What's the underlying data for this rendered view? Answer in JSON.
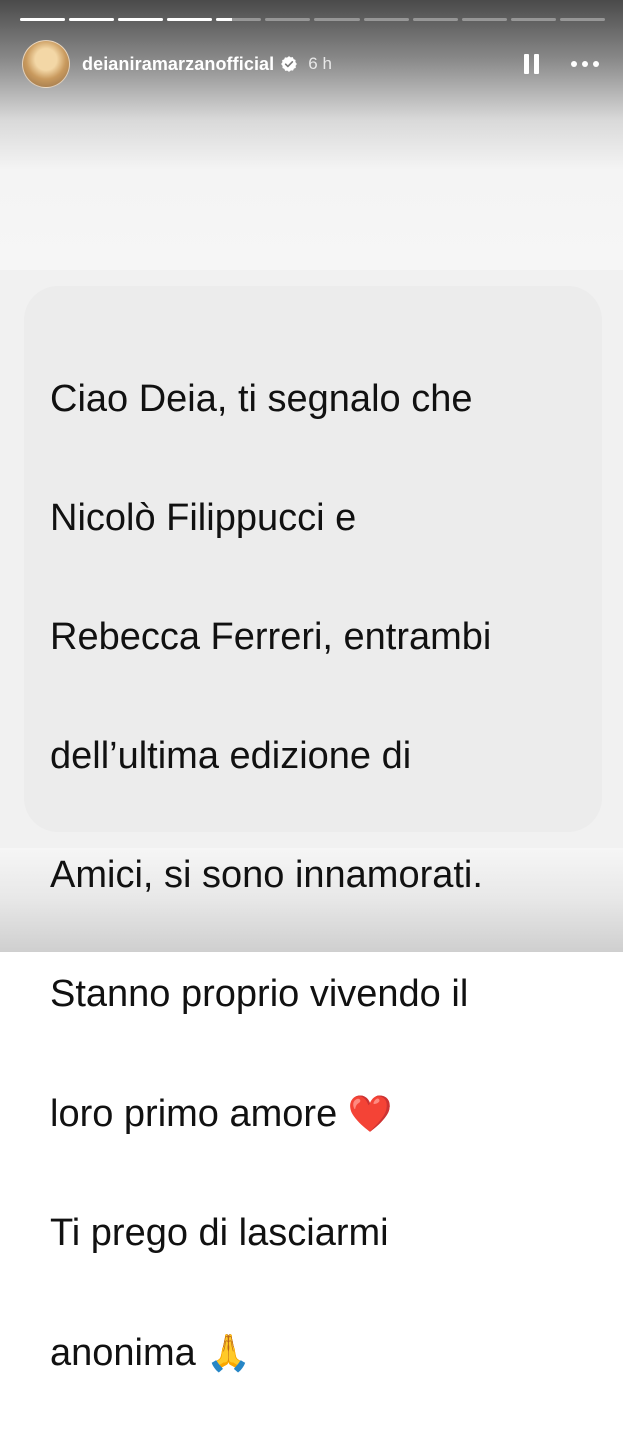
{
  "story": {
    "progress_segments": 12,
    "progress_completed": 4,
    "progress_current_fraction": 0.35,
    "username": "deianiramarzanofficial",
    "time_ago": "6 h",
    "verified": true,
    "icons": [
      "pause-icon",
      "more-icon",
      "verified-icon"
    ]
  },
  "message": {
    "lines": [
      "Ciao Deia, ti segnalo che",
      "Nicolò Filippucci e",
      "Rebecca Ferreri, entrambi",
      "dell’ultima edizione di",
      "Amici, si sono innamorati.",
      "Stanno proprio vivendo il",
      "loro primo amore",
      "Ti prego di lasciarmi",
      "anonima"
    ],
    "heart_emoji": "❤️",
    "praying_emoji": "🙏"
  },
  "colors": {
    "bubble": "#ececec",
    "text": "#111111",
    "heart": "#e11d2a"
  }
}
